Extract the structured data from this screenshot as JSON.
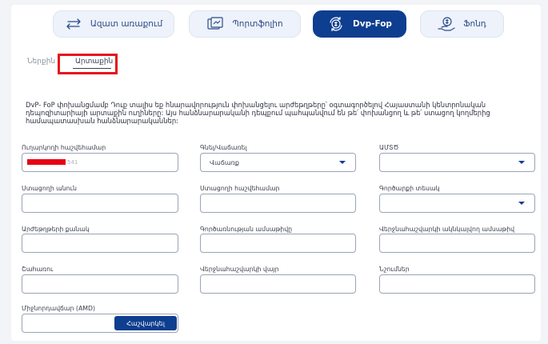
{
  "tabs": [
    {
      "label": "Ազատ առաքում",
      "icon": "swap-arrows-icon",
      "active": false
    },
    {
      "label": "Պորտֆոլիո",
      "icon": "portfolio-icon",
      "active": false
    },
    {
      "label": "Dvp-Fop",
      "icon": "coin-exchange-icon",
      "active": true
    },
    {
      "label": "Ֆոնդ",
      "icon": "fund-icon",
      "active": false
    }
  ],
  "subtabs": [
    {
      "label": "Ներքին",
      "active": false
    },
    {
      "label": "Արտաքին",
      "active": true
    }
  ],
  "description": "DvP- FoP փոխանցմամբ Դուք տալիս եք հնարավորություն փոխանցելու արժեթղթերը՝ օգտագործելով Հայաստանի կենտրոնական դեպոզիտարիայի արտաքին ուղիները: Այս հանձնարարականի դեպքում պահպանվում են թե՛ փոխանցող և թե՛ ստացող կողմերից համապատասխան հանձնարարականներ:",
  "form": {
    "sender_account_label": "Ուղարկողի հաշվեհամար",
    "sender_account_suffix": "541",
    "buy_sell_label": "Գնել/Վաճառել",
    "buy_sell_value": "Վաճառք",
    "isin_label": "ԱՄՏԾ",
    "receiver_name_label": "Ստացողի անուն",
    "receiver_account_label": "Ստացողի հաշվեհամար",
    "operation_type_label": "Գործարքի տեսակ",
    "securities_quantity_label": "Արժեթղթերի քանակ",
    "transaction_date_label": "Գործառնության ամսաթիվը",
    "settlement_date_label": "Վերջնահաշվարկի ակնկալվող ամսաթիվ",
    "price_label": "Շահառու",
    "settlement_place_label": "Վերջնահաշվարկի վայր",
    "notes_label": "Նշումներ",
    "broker_fee_label": "Միջնորդավճար (AMD)",
    "calculate_button": "Հաշվարկել"
  },
  "colors": {
    "accent": "#0e3e8f",
    "tab_bg": "#eef2fb",
    "highlight": "#e4141b",
    "redaction": "#e80014"
  }
}
